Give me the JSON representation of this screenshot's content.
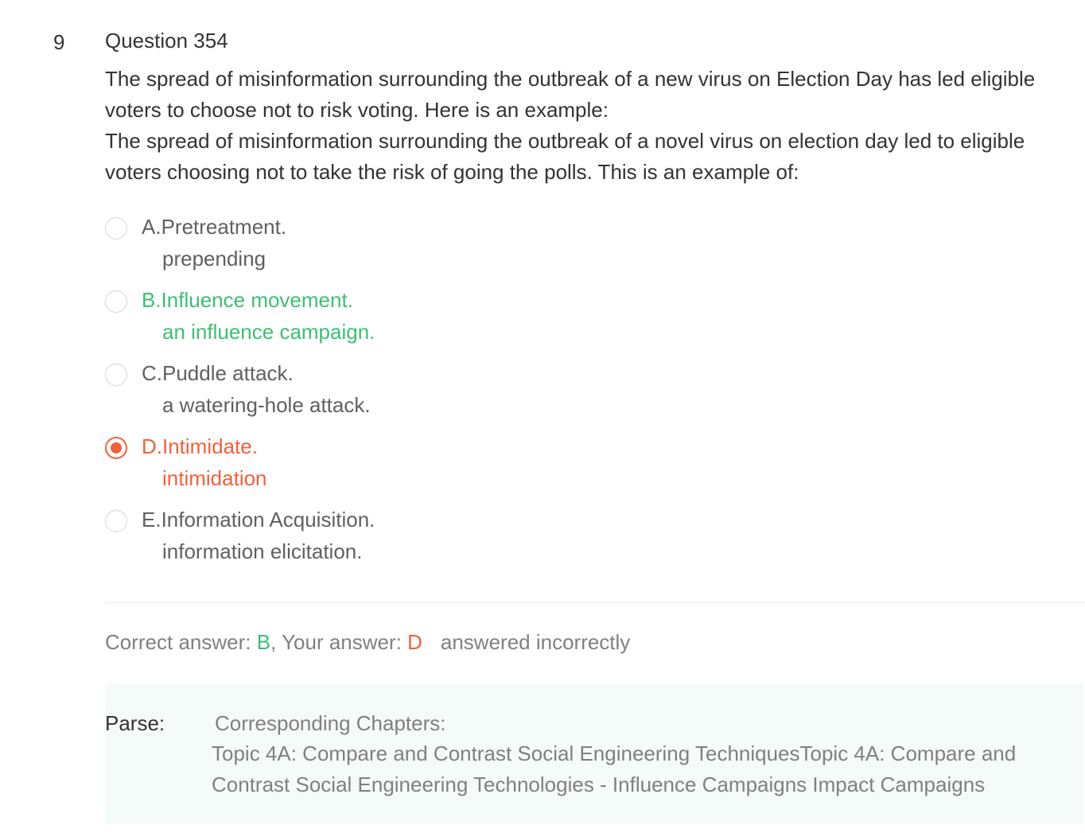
{
  "question": {
    "number": "9",
    "title": "Question 354",
    "stem_line1": "The spread of misinformation surrounding the outbreak of a new virus on Election Day has led eligible voters to choose not to risk voting. Here is an example:",
    "stem_line2": "The spread of misinformation surrounding the outbreak of a novel virus on election day led to eligible voters choosing not to take the risk of going the polls. This is an example of:"
  },
  "options": [
    {
      "main": "A.Pretreatment.",
      "sub": "prepending",
      "state": "normal"
    },
    {
      "main": "B.Influence movement.",
      "sub": "an influence campaign.",
      "state": "correct"
    },
    {
      "main": "C.Puddle attack.",
      "sub": "a watering-hole attack.",
      "state": "normal"
    },
    {
      "main": "D.Intimidate.",
      "sub": "intimidation",
      "state": "selected-wrong"
    },
    {
      "main": "E.Information Acquisition.",
      "sub": "information elicitation.",
      "state": "normal"
    }
  ],
  "result": {
    "correct_label": "Correct answer: ",
    "correct_value": "B",
    "separator": ", ",
    "your_label": "Your answer: ",
    "your_value": "D",
    "status": "answered incorrectly"
  },
  "parse": {
    "label": "Parse:",
    "chapters_label": "Corresponding Chapters:",
    "topic": "Topic 4A: Compare and Contrast Social Engineering TechniquesTopic 4A: Compare and Contrast Social Engineering Technologies - Influence Campaigns Impact Campaigns"
  },
  "colors": {
    "correct": "#3cbf74",
    "wrong": "#f5603a",
    "muted": "#808080",
    "parse_bg": "#f5fbf8"
  }
}
